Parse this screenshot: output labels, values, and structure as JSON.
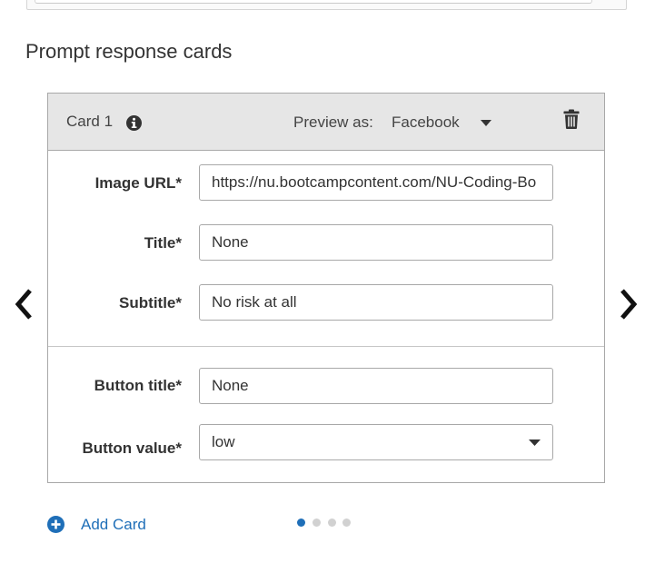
{
  "section_title": "Prompt response cards",
  "card": {
    "title": "Card 1",
    "preview_label": "Preview as:",
    "preview_value": "Facebook",
    "fields": {
      "image_url": {
        "label": "Image URL*",
        "value": "https://nu.bootcampcontent.com/NU-Coding-Bo"
      },
      "title": {
        "label": "Title*",
        "value": "None"
      },
      "subtitle": {
        "label": "Subtitle*",
        "value": "No risk at all"
      },
      "button_title": {
        "label": "Button title*",
        "value": "None"
      },
      "button_value": {
        "label": "Button value*",
        "value": "low"
      }
    }
  },
  "add_card_label": "Add Card",
  "pagination": {
    "total": 4,
    "current": 1
  },
  "colors": {
    "accent": "#1f6fb8",
    "header_bg": "#e6e6e6",
    "border": "#a8a8a8",
    "dot_inactive": "#d1d1d1"
  },
  "icons": {
    "info": "info-icon",
    "delete": "trash-icon",
    "prev": "chevron-left-icon",
    "next": "chevron-right-icon",
    "add": "plus-circle-icon",
    "dropdown": "caret-down-icon"
  }
}
